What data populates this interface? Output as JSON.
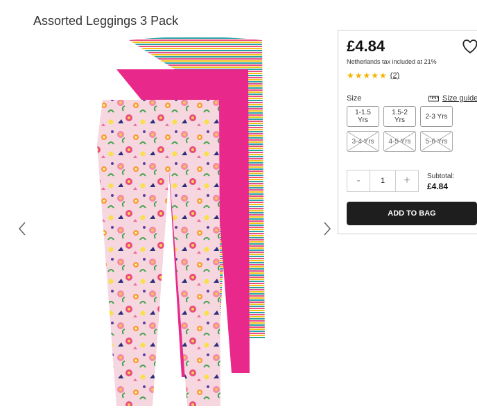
{
  "page": {
    "title": "Assorted Leggings 3 Pack"
  },
  "gallery": {
    "prev_icon": "chevron-left-icon",
    "next_icon": "chevron-right-icon",
    "image_alt": "Assorted Leggings 3 Pack: striped, pink and floral leggings"
  },
  "product": {
    "price": "£4.84",
    "tax_note": "Netherlands tax included at 21%",
    "rating_stars": "★★★★★",
    "rating_value": 5,
    "review_count": "(2)",
    "size_label": "Size",
    "size_guide_label": "Size guide",
    "sizes": [
      {
        "label": "1-1.5 Yrs",
        "available": true
      },
      {
        "label": "1.5-2 Yrs",
        "available": true
      },
      {
        "label": "2-3 Yrs",
        "available": true
      },
      {
        "label": "3-4 Yrs",
        "available": false
      },
      {
        "label": "4-5 Yrs",
        "available": false
      },
      {
        "label": "5-6 Yrs",
        "available": false
      }
    ],
    "quantity": "1",
    "minus_label": "-",
    "plus_label": "+",
    "subtotal_label": "Subtotal:",
    "subtotal_value": "£4.84",
    "add_to_bag_label": "ADD TO BAG"
  },
  "colors": {
    "accent": "#1e1e1e",
    "star": "#f5b400",
    "legging_pink": "#e8288a",
    "floral_base": "#f6cfd8"
  }
}
